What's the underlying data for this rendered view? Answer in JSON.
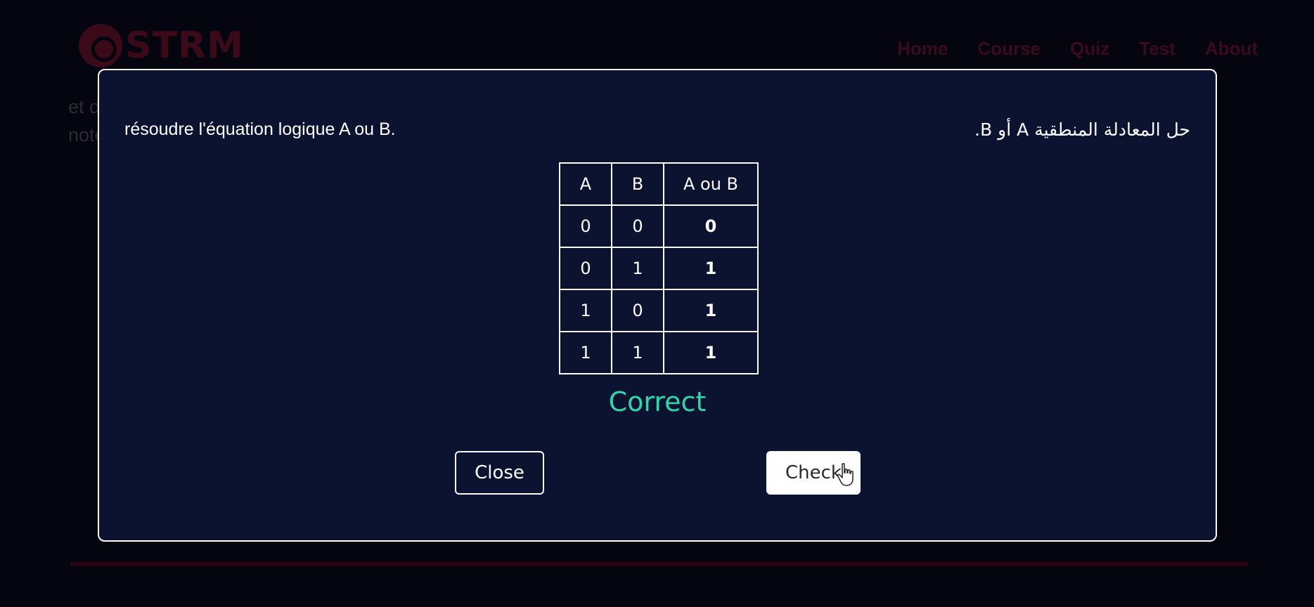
{
  "background": {
    "logo_text": "STRM",
    "nav": [
      "Home",
      "Course",
      "Quiz",
      "Test",
      "About"
    ],
    "text_fragments": [
      "et d",
      "note"
    ]
  },
  "modal": {
    "question_fr": "résoudre l'équation logique A ou B.",
    "question_ar": "حل المعادلة المنطقية A أو B.",
    "table": {
      "headers": [
        "A",
        "B",
        "A ou B"
      ],
      "rows": [
        [
          "0",
          "0",
          "0"
        ],
        [
          "0",
          "1",
          "1"
        ],
        [
          "1",
          "0",
          "1"
        ],
        [
          "1",
          "1",
          "1"
        ]
      ]
    },
    "result": "Correct",
    "close_label": "Close",
    "check_label": "Check"
  },
  "colors": {
    "modal_bg": "#0c1330",
    "result": "#2fd6a8",
    "brand": "#3a0a18"
  },
  "icons": [
    "hand-pointer-icon"
  ]
}
